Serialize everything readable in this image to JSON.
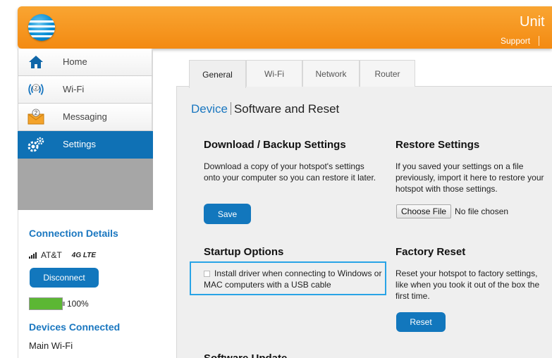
{
  "header": {
    "brand_text": "Unit",
    "support_label": "Support"
  },
  "nav": {
    "items": [
      {
        "label": "Home",
        "icon": "home-icon"
      },
      {
        "label": "Wi-Fi",
        "icon": "wifi-icon",
        "badge": "2"
      },
      {
        "label": "Messaging",
        "icon": "envelope-icon",
        "badge": "2"
      },
      {
        "label": "Settings",
        "icon": "gears-icon",
        "active": true
      }
    ]
  },
  "connection": {
    "title": "Connection Details",
    "carrier": "AT&T",
    "network": "4G LTE",
    "disconnect_label": "Disconnect",
    "battery_percent": "100%",
    "battery_level": 1.0,
    "devices_title": "Devices Connected",
    "device_group": "Main Wi-Fi"
  },
  "tabs": [
    "General",
    "Wi-Fi",
    "Network",
    "Router"
  ],
  "breadcrumb": {
    "parent": "Device",
    "current": "Software and Reset"
  },
  "download": {
    "title": "Download / Backup Settings",
    "text": "Download a copy of your hotspot's settings onto your computer so you can restore it later.",
    "button": "Save"
  },
  "restore": {
    "title": "Restore Settings",
    "text": "If you saved your settings on a file previously, import it here to restore your hotspot with those settings.",
    "file_button": "Choose File",
    "file_status": "No file chosen"
  },
  "startup": {
    "title": "Startup Options",
    "checkbox_label": "Install driver when connecting to Windows or MAC computers with a USB cable",
    "checked": false
  },
  "factory": {
    "title": "Factory Reset",
    "text": "Reset your hotspot to factory settings, like when you took it out of the box the first time.",
    "button": "Reset"
  },
  "software_update": {
    "title": "Software Update"
  },
  "colors": {
    "header_orange": "#f5961e",
    "accent_blue": "#1277bd",
    "highlight": "#29a4e6",
    "battery_green": "#5cb734"
  }
}
